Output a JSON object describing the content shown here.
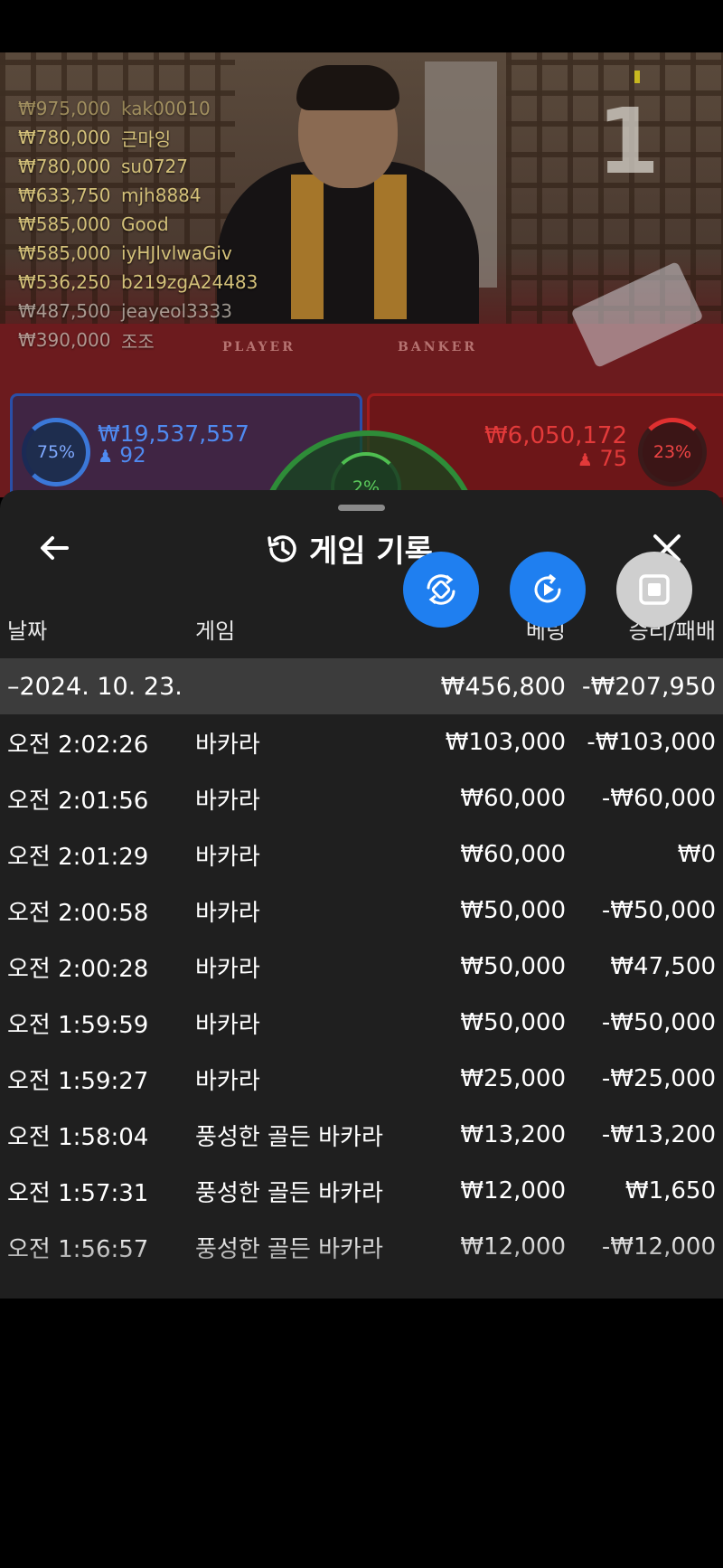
{
  "video": {
    "round_number": "1",
    "table_labels": {
      "player": "PLAYER",
      "banker": "BANKER"
    },
    "winners": [
      {
        "amount": "₩975,000",
        "user": "kak00010"
      },
      {
        "amount": "₩780,000",
        "user": "근마잉"
      },
      {
        "amount": "₩780,000",
        "user": "su0727"
      },
      {
        "amount": "₩633,750",
        "user": "mjh8884"
      },
      {
        "amount": "₩585,000",
        "user": "Good"
      },
      {
        "amount": "₩585,000",
        "user": "iyHJlvlwaGiv"
      },
      {
        "amount": "₩536,250",
        "user": "b219zgA24483"
      },
      {
        "amount": "₩487,500",
        "user": "jeayeol3333"
      },
      {
        "amount": "₩390,000",
        "user": "조조"
      }
    ],
    "player": {
      "percent": "75%",
      "amount": "₩19,537,557",
      "count": "92",
      "color": "#3b78d8"
    },
    "banker": {
      "percent": "23%",
      "amount": "₩6,050,172",
      "count": "75",
      "color": "#e03030"
    },
    "tie": {
      "percent": "2%",
      "color": "#4ebe50"
    }
  },
  "sheet": {
    "title": "게임 기록",
    "columns": {
      "date": "날짜",
      "game": "게임",
      "bet": "베팅",
      "result": "승리/패배"
    },
    "date_group": {
      "date": "–2024. 10. 23.",
      "bet": "₩456,800",
      "result": "-₩207,950"
    },
    "rows": [
      {
        "time": "오전 2:02:26",
        "game": "바카라",
        "bet": "₩103,000",
        "result": "-₩103,000"
      },
      {
        "time": "오전 2:01:56",
        "game": "바카라",
        "bet": "₩60,000",
        "result": "-₩60,000"
      },
      {
        "time": "오전 2:01:29",
        "game": "바카라",
        "bet": "₩60,000",
        "result": "₩0"
      },
      {
        "time": "오전 2:00:58",
        "game": "바카라",
        "bet": "₩50,000",
        "result": "-₩50,000"
      },
      {
        "time": "오전 2:00:28",
        "game": "바카라",
        "bet": "₩50,000",
        "result": "₩47,500"
      },
      {
        "time": "오전 1:59:59",
        "game": "바카라",
        "bet": "₩50,000",
        "result": "-₩50,000"
      },
      {
        "time": "오전 1:59:27",
        "game": "바카라",
        "bet": "₩25,000",
        "result": "-₩25,000"
      },
      {
        "time": "오전 1:58:04",
        "game": "풍성한 골든 바카라",
        "bet": "₩13,200",
        "result": "-₩13,200"
      },
      {
        "time": "오전 1:57:31",
        "game": "풍성한 골든 바카라",
        "bet": "₩12,000",
        "result": "₩1,650"
      },
      {
        "time": "오전 1:56:57",
        "game": "풍성한 골든 바카라",
        "bet": "₩12,000",
        "result": "-₩12,000"
      }
    ]
  },
  "floating_buttons": [
    {
      "icon": "rotate-icon",
      "color": "#1f7ff0"
    },
    {
      "icon": "replay-icon",
      "color": "#1f7ff0"
    },
    {
      "icon": "stop-icon",
      "color": "#cfcfcf"
    }
  ]
}
